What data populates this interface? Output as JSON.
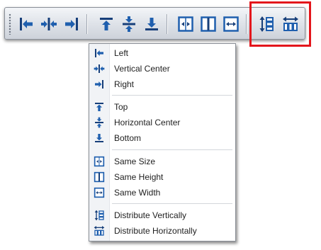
{
  "colors": {
    "icon_blue": "#1f5fae",
    "icon_dark": "#173f7a",
    "highlight_red": "#e3161c"
  },
  "toolbar": {
    "buttons": [
      {
        "id": "left",
        "icon": "align-left-icon"
      },
      {
        "id": "vertical-center",
        "icon": "align-vertical-center-icon"
      },
      {
        "id": "right",
        "icon": "align-right-icon"
      },
      {
        "id": "top",
        "icon": "align-top-icon"
      },
      {
        "id": "horizontal-center",
        "icon": "align-horizontal-center-icon"
      },
      {
        "id": "bottom",
        "icon": "align-bottom-icon"
      },
      {
        "id": "same-size",
        "icon": "same-size-icon"
      },
      {
        "id": "same-height",
        "icon": "same-height-icon"
      },
      {
        "id": "same-width",
        "icon": "same-width-icon"
      },
      {
        "id": "distribute-vertically",
        "icon": "distribute-vertically-icon"
      },
      {
        "id": "distribute-horizontally",
        "icon": "distribute-horizontally-icon"
      }
    ]
  },
  "menu": {
    "items": [
      {
        "label": "Left",
        "icon": "align-left-icon"
      },
      {
        "label": "Vertical Center",
        "icon": "align-vertical-center-icon"
      },
      {
        "label": "Right",
        "icon": "align-right-icon"
      },
      {
        "label": "Top",
        "icon": "align-top-icon"
      },
      {
        "label": "Horizontal Center",
        "icon": "align-horizontal-center-icon"
      },
      {
        "label": "Bottom",
        "icon": "align-bottom-icon"
      },
      {
        "label": "Same Size",
        "icon": "same-size-icon"
      },
      {
        "label": "Same Height",
        "icon": "same-height-icon"
      },
      {
        "label": "Same Width",
        "icon": "same-width-icon"
      },
      {
        "label": "Distribute Vertically",
        "icon": "distribute-vertically-icon"
      },
      {
        "label": "Distribute Horizontally",
        "icon": "distribute-horizontally-icon"
      }
    ]
  }
}
